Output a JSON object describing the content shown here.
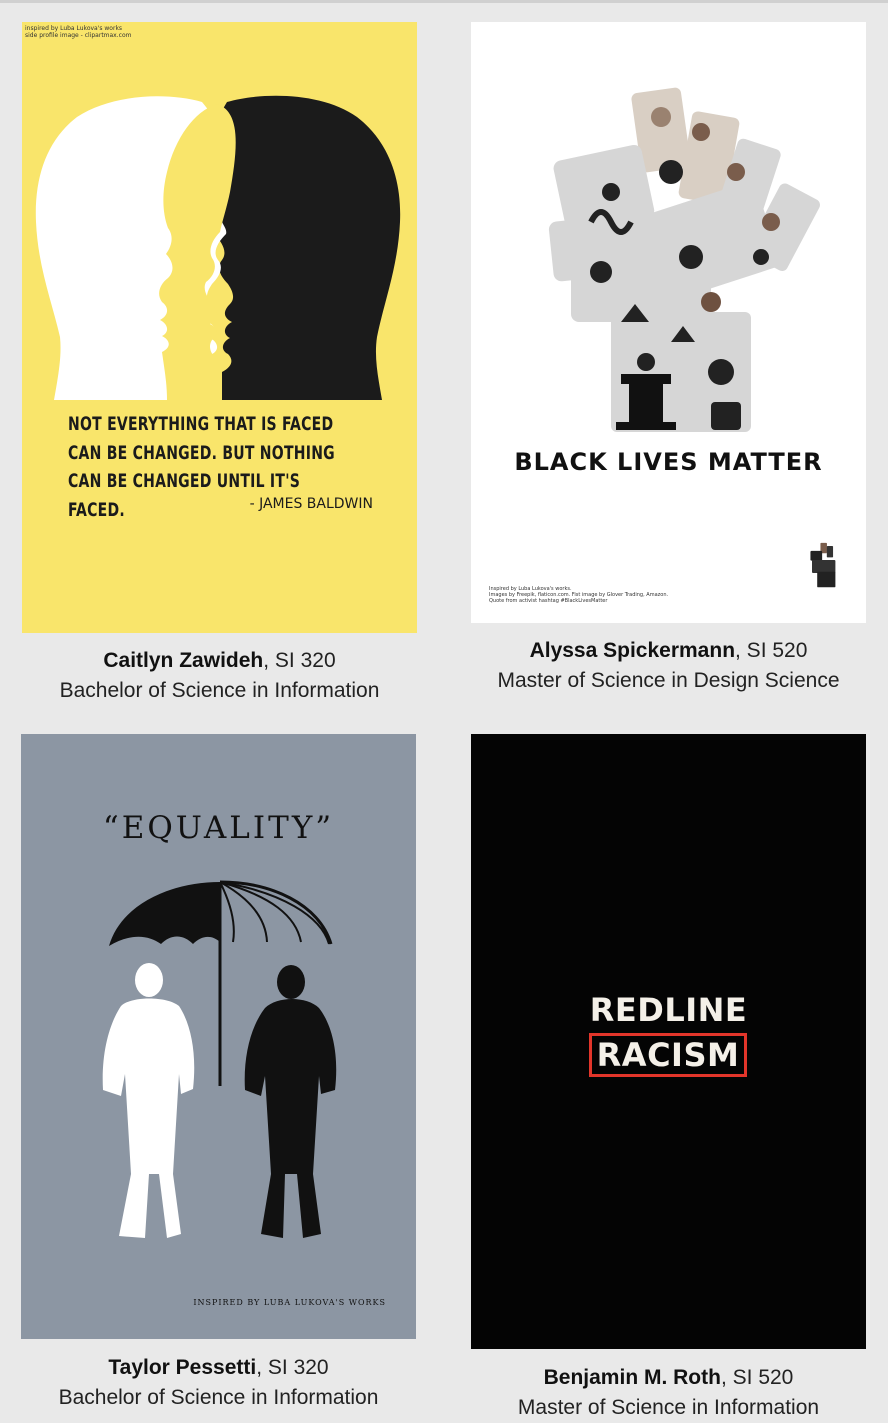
{
  "cards": [
    {
      "author": "Caitlyn Zawideh",
      "course": ", SI 320",
      "program": "Bachelor of Science in Information",
      "poster": {
        "credit_line1": "inspired by Luba Lukova's works",
        "credit_line2": "side profile image - clipartmax.com",
        "quote": "NOT EVERYTHING THAT IS FACED CAN BE CHANGED. BUT NOTHING CAN BE CHANGED UNTIL IT'S FACED.",
        "attribution": "- JAMES BALDWIN",
        "bg_color": "#f9e56b"
      }
    },
    {
      "author": "Alyssa Spickermann",
      "course": ", SI 520",
      "program": "Master of Science in Design Science",
      "poster": {
        "title": "BLACK LIVES MATTER",
        "credit_line1": "Inspired by Luba Lukova's works.",
        "credit_line2": "Images by Freepik, flaticon.com. Fist image by Glover Trading, Amazon.",
        "credit_line3": "Quote from activist hashtag #BlackLivesMatter",
        "bg_color": "#ffffff"
      }
    },
    {
      "author": "Taylor Pessetti",
      "course": ", SI 320",
      "program": "Bachelor of Science in Information",
      "poster": {
        "title": "“EQUALITY”",
        "credit": "INSPIRED BY LUBA LUKOVA'S WORKS",
        "bg_color": "#8c96a3"
      }
    },
    {
      "author": "Benjamin M. Roth",
      "course": ", SI 520",
      "program": "Master of Science in Information",
      "poster": {
        "line1": "REDLINE",
        "line2": "RACISM",
        "bg_color": "#040404",
        "accent": "#e2352a"
      }
    }
  ]
}
